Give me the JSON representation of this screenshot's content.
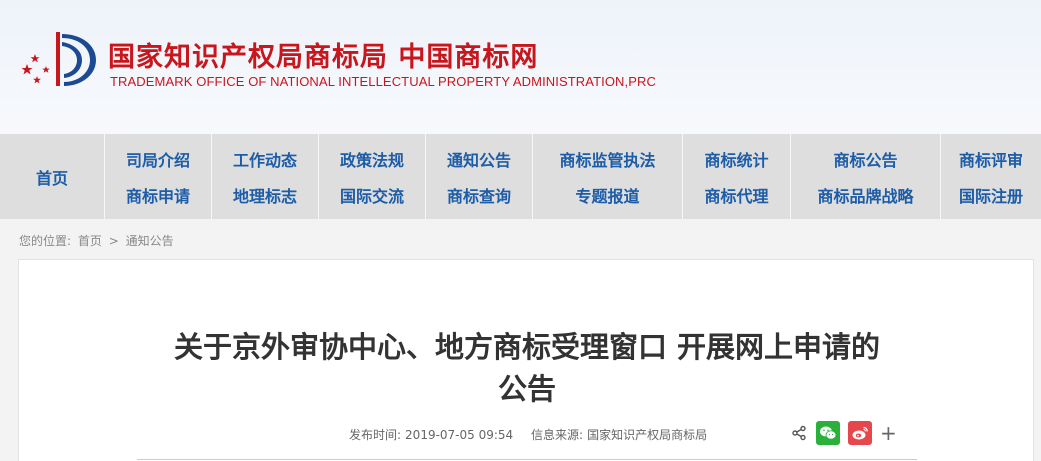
{
  "header": {
    "title_cn": "国家知识产权局商标局 中国商标网",
    "title_en": "TRADEMARK OFFICE OF NATIONAL INTELLECTUAL PROPERTY ADMINISTRATION,PRC",
    "brand_color": "#c8161d"
  },
  "nav": {
    "home": "首页",
    "columns": [
      {
        "top": "司局介绍",
        "bottom": "商标申请"
      },
      {
        "top": "工作动态",
        "bottom": "地理标志"
      },
      {
        "top": "政策法规",
        "bottom": "国际交流"
      },
      {
        "top": "通知公告",
        "bottom": "商标查询"
      },
      {
        "top": "商标监管执法",
        "bottom": "专题报道"
      },
      {
        "top": "商标统计",
        "bottom": "商标代理"
      },
      {
        "top": "商标公告",
        "bottom": "商标品牌战略"
      },
      {
        "top": "商标评审",
        "bottom": "国际注册"
      }
    ],
    "link_color": "#1d5ca7"
  },
  "breadcrumb": {
    "prefix": "您的位置:",
    "home": "首页",
    "sep": ">",
    "current": "通知公告"
  },
  "article": {
    "title_line1": "关于京外审协中心、地方商标受理窗口 开展网上申请的",
    "title_line2": "公告",
    "published_label": "发布时间:",
    "published_value": "2019-07-05 09:54",
    "source_label": "信息来源:",
    "source_value": "国家知识产权局商标局"
  },
  "share": {
    "icons": [
      "share-icon",
      "wechat-icon",
      "weibo-icon",
      "plus-icon"
    ],
    "plus": "+",
    "wechat_color": "#2bb03c",
    "weibo_color": "#e6474d"
  }
}
